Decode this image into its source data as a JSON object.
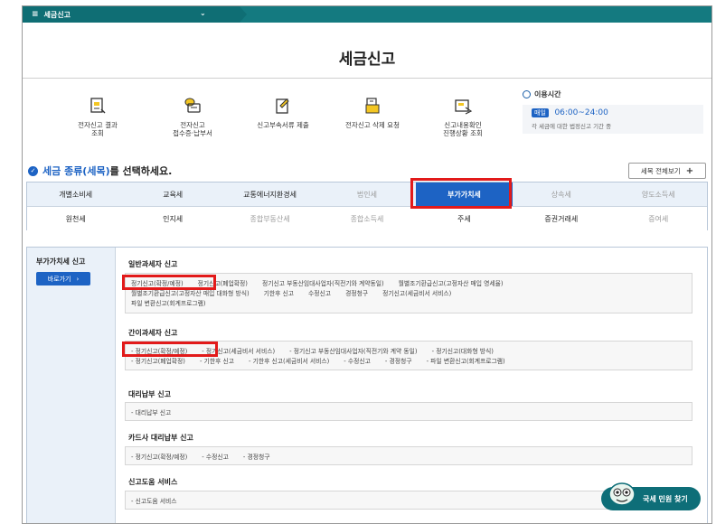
{
  "menu": {
    "label": "세금신고"
  },
  "page_title": "세금신고",
  "services": [
    {
      "label": "전자신고 결과\n조회",
      "icon": "report-result-icon"
    },
    {
      "label": "전자신고\n접수증·납부서",
      "icon": "receipt-icon"
    },
    {
      "label": "신고부속서류 제출",
      "icon": "document-submit-icon"
    },
    {
      "label": "전자신고 삭제 요청",
      "icon": "trash-icon"
    },
    {
      "label": "신고내용확인\n진행상황 조회",
      "icon": "progress-check-icon"
    }
  ],
  "hours": {
    "title": "이용시간",
    "badge": "매일",
    "time": "06:00~24:00",
    "note": "각 세금에 대한 법정신고 기간 중"
  },
  "tax_section": {
    "heading_highlight": "세금 종류(세목)",
    "heading_rest": "를 선택하세요.",
    "view_all_label": "세목 전체보기"
  },
  "tax_row1": [
    "개별소비세",
    "교육세",
    "교통에너지환경세",
    "법인세",
    "부가가치세",
    "상속세",
    "양도소득세"
  ],
  "tax_row2": [
    "원천세",
    "인지세",
    "종합부동산세",
    "종합소득세",
    "주세",
    "증권거래세",
    "증여세"
  ],
  "side": {
    "title": "부가가치세 신고",
    "go_label": "바로가기"
  },
  "groups": {
    "general": {
      "title": "일반과세자 신고",
      "line1": [
        "정기신고(확정/예정)",
        "정기신고(폐업확정)",
        "정기신고 부동산임대사업자(직전기와 계약동일)",
        "월별조기환급신고(고정자산 매입 영세율)"
      ],
      "line2": [
        "월별조기환급신고(고정자산 매입 대화형 방식)",
        "기한후 신고",
        "수정신고",
        "경정청구",
        "정기신고(세금비서 서비스)"
      ],
      "line3": [
        "파일 변환신고(회계프로그램)"
      ]
    },
    "simple": {
      "title": "간이과세자 신고",
      "line1": [
        "- 정기신고(확정/예정)",
        "- 정기신고(세금비서 서비스)",
        "- 정기신고 부동산임대사업자(직전기와 계약 동일)",
        "- 정기신고(대화형 방식)"
      ],
      "line2": [
        "- 정기신고(폐업확정)",
        "- 기한후 신고",
        "- 기한후 신고(세금비서 서비스)",
        "- 수정신고",
        "- 경정청구",
        "- 파일 변환신고(회계프로그램)"
      ]
    },
    "agent": {
      "title": "대리납부 신고",
      "items": [
        "- 대리납부 신고"
      ]
    },
    "card": {
      "title": "카드사 대리납부 신고",
      "items": [
        "- 정기신고(확정/예정)",
        "- 수정신고",
        "- 경정청구"
      ]
    },
    "help": {
      "title": "신고도움 서비스",
      "items": [
        "- 신고도움 서비스"
      ]
    }
  },
  "fab_label": "국세 민원 찾기"
}
